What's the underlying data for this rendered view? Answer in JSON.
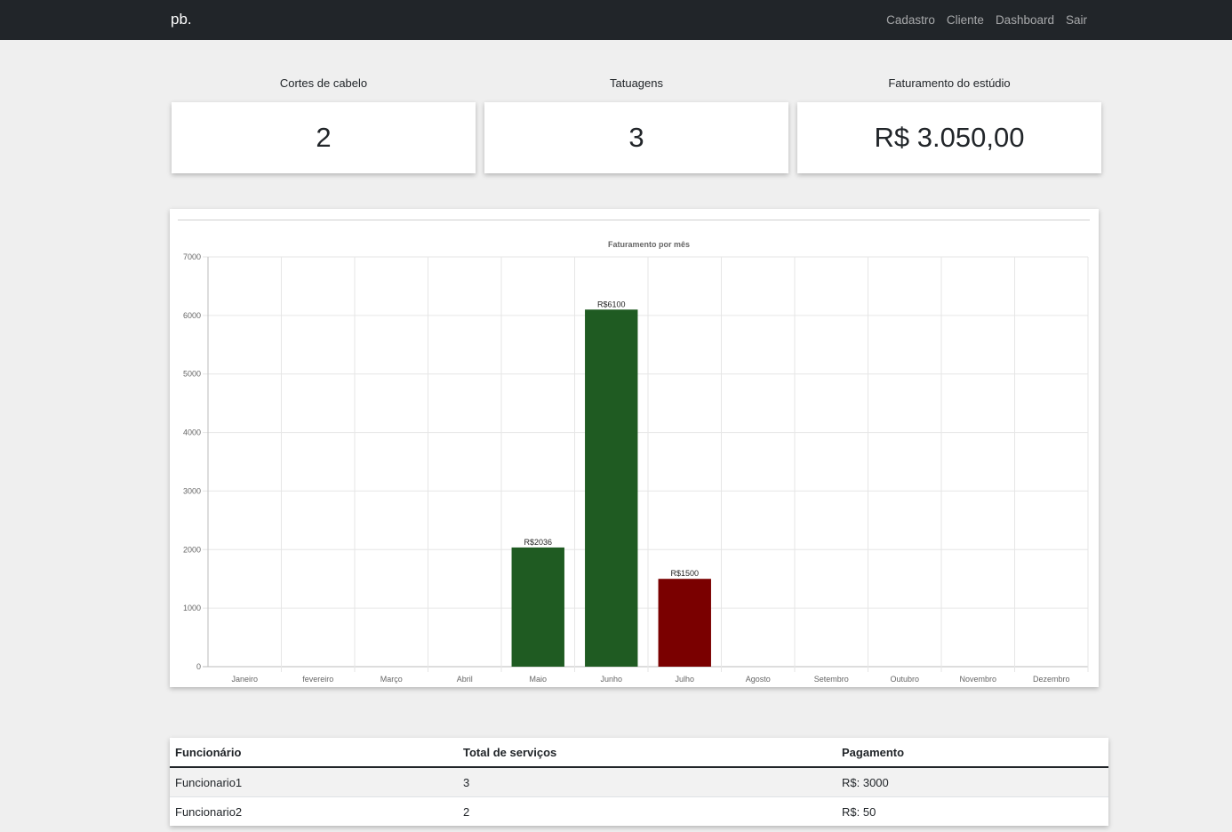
{
  "navbar": {
    "brand": "pb.",
    "links": [
      "Cadastro",
      "Cliente",
      "Dashboard",
      "Sair"
    ]
  },
  "stats": [
    {
      "label": "Cortes de cabelo",
      "value": "2"
    },
    {
      "label": "Tatuagens",
      "value": "3"
    },
    {
      "label": "Faturamento do estúdio",
      "value": "R$ 3.050,00"
    }
  ],
  "chart_data": {
    "type": "bar",
    "title": "Faturamento por mês",
    "xlabel": "",
    "ylabel": "",
    "categories": [
      "Janeiro",
      "fevereiro",
      "Março",
      "Abril",
      "Maio",
      "Junho",
      "Julho",
      "Agosto",
      "Setembro",
      "Outubro",
      "Novembro",
      "Dezembro"
    ],
    "values": [
      0,
      0,
      0,
      0,
      2036,
      6100,
      1500,
      0,
      0,
      0,
      0,
      0
    ],
    "data_labels": [
      "",
      "",
      "",
      "",
      "R$2036",
      "R$6100",
      "R$1500",
      "",
      "",
      "",
      "",
      ""
    ],
    "bar_colors": [
      "#1f5b22",
      "#1f5b22",
      "#1f5b22",
      "#1f5b22",
      "#1f5b22",
      "#1f5b22",
      "#7a0000",
      "#1f5b22",
      "#1f5b22",
      "#1f5b22",
      "#1f5b22",
      "#1f5b22"
    ],
    "ylim": [
      0,
      7000
    ],
    "yticks": [
      0,
      1000,
      2000,
      3000,
      4000,
      5000,
      6000,
      7000
    ],
    "grid": true,
    "legend": "none"
  },
  "table": {
    "headers": [
      "Funcionário",
      "Total de serviços",
      "Pagamento"
    ],
    "rows": [
      [
        "Funcionario1",
        "3",
        "R$: 3000"
      ],
      [
        "Funcionario2",
        "2",
        "R$: 50"
      ]
    ]
  }
}
